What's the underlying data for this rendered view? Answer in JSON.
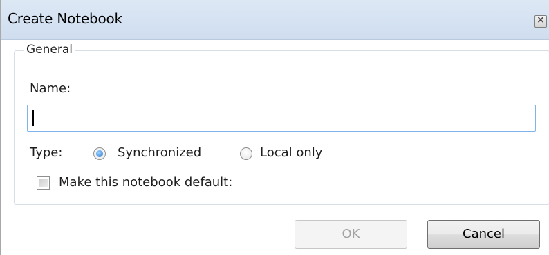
{
  "dialog": {
    "title": "Create Notebook",
    "close_icon": "close-icon"
  },
  "general": {
    "legend": "General",
    "name_label": "Name:",
    "name_value": "",
    "type_label": "Type:",
    "type_options": [
      {
        "label": "Synchronized",
        "selected": true
      },
      {
        "label": "Local only",
        "selected": false
      }
    ],
    "default_checkbox_label": "Make this notebook default:",
    "default_checked": false
  },
  "buttons": {
    "ok_label": "OK",
    "ok_enabled": false,
    "cancel_label": "Cancel"
  },
  "colors": {
    "titlebar": "#cfddef",
    "input_border": "#7eb4ea",
    "radio_accent": "#1f6fd0"
  }
}
